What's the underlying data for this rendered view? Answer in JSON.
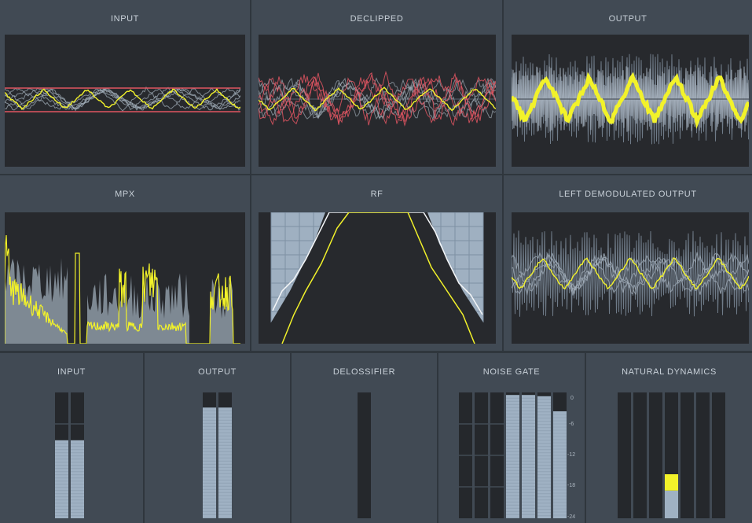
{
  "scopes": [
    {
      "title": "INPUT"
    },
    {
      "title": "DECLIPPED"
    },
    {
      "title": "OUTPUT"
    },
    {
      "title": "MPX"
    },
    {
      "title": "RF"
    },
    {
      "title": "LEFT DEMODULATED OUTPUT"
    }
  ],
  "meters": [
    {
      "title": "INPUT",
      "levels": [
        0.62,
        0.62
      ]
    },
    {
      "title": "OUTPUT",
      "levels": [
        0.88,
        0.88
      ]
    },
    {
      "title": "DELOSSIFIER",
      "levels": [
        0.0
      ]
    },
    {
      "title": "NOISE GATE",
      "levels": [
        0.0,
        0.0,
        0.0,
        0.98,
        0.98,
        0.97,
        0.85
      ]
    },
    {
      "title": "NATURAL DYNAMICS",
      "levels": [
        0,
        0,
        0,
        0.22,
        0,
        0,
        0
      ],
      "highlight": 0.35
    }
  ],
  "noise_gate_scale": [
    "0",
    "-6",
    "-12",
    "-18",
    "-24"
  ],
  "colors": {
    "background": "#2f363d",
    "panel": "#414a54",
    "screen": "#27292d",
    "trace_yellow": "#f2f22a",
    "trace_red": "#e05561",
    "trace_grey": "#a7b3bf",
    "meter_fill": "#9fb1c3"
  }
}
